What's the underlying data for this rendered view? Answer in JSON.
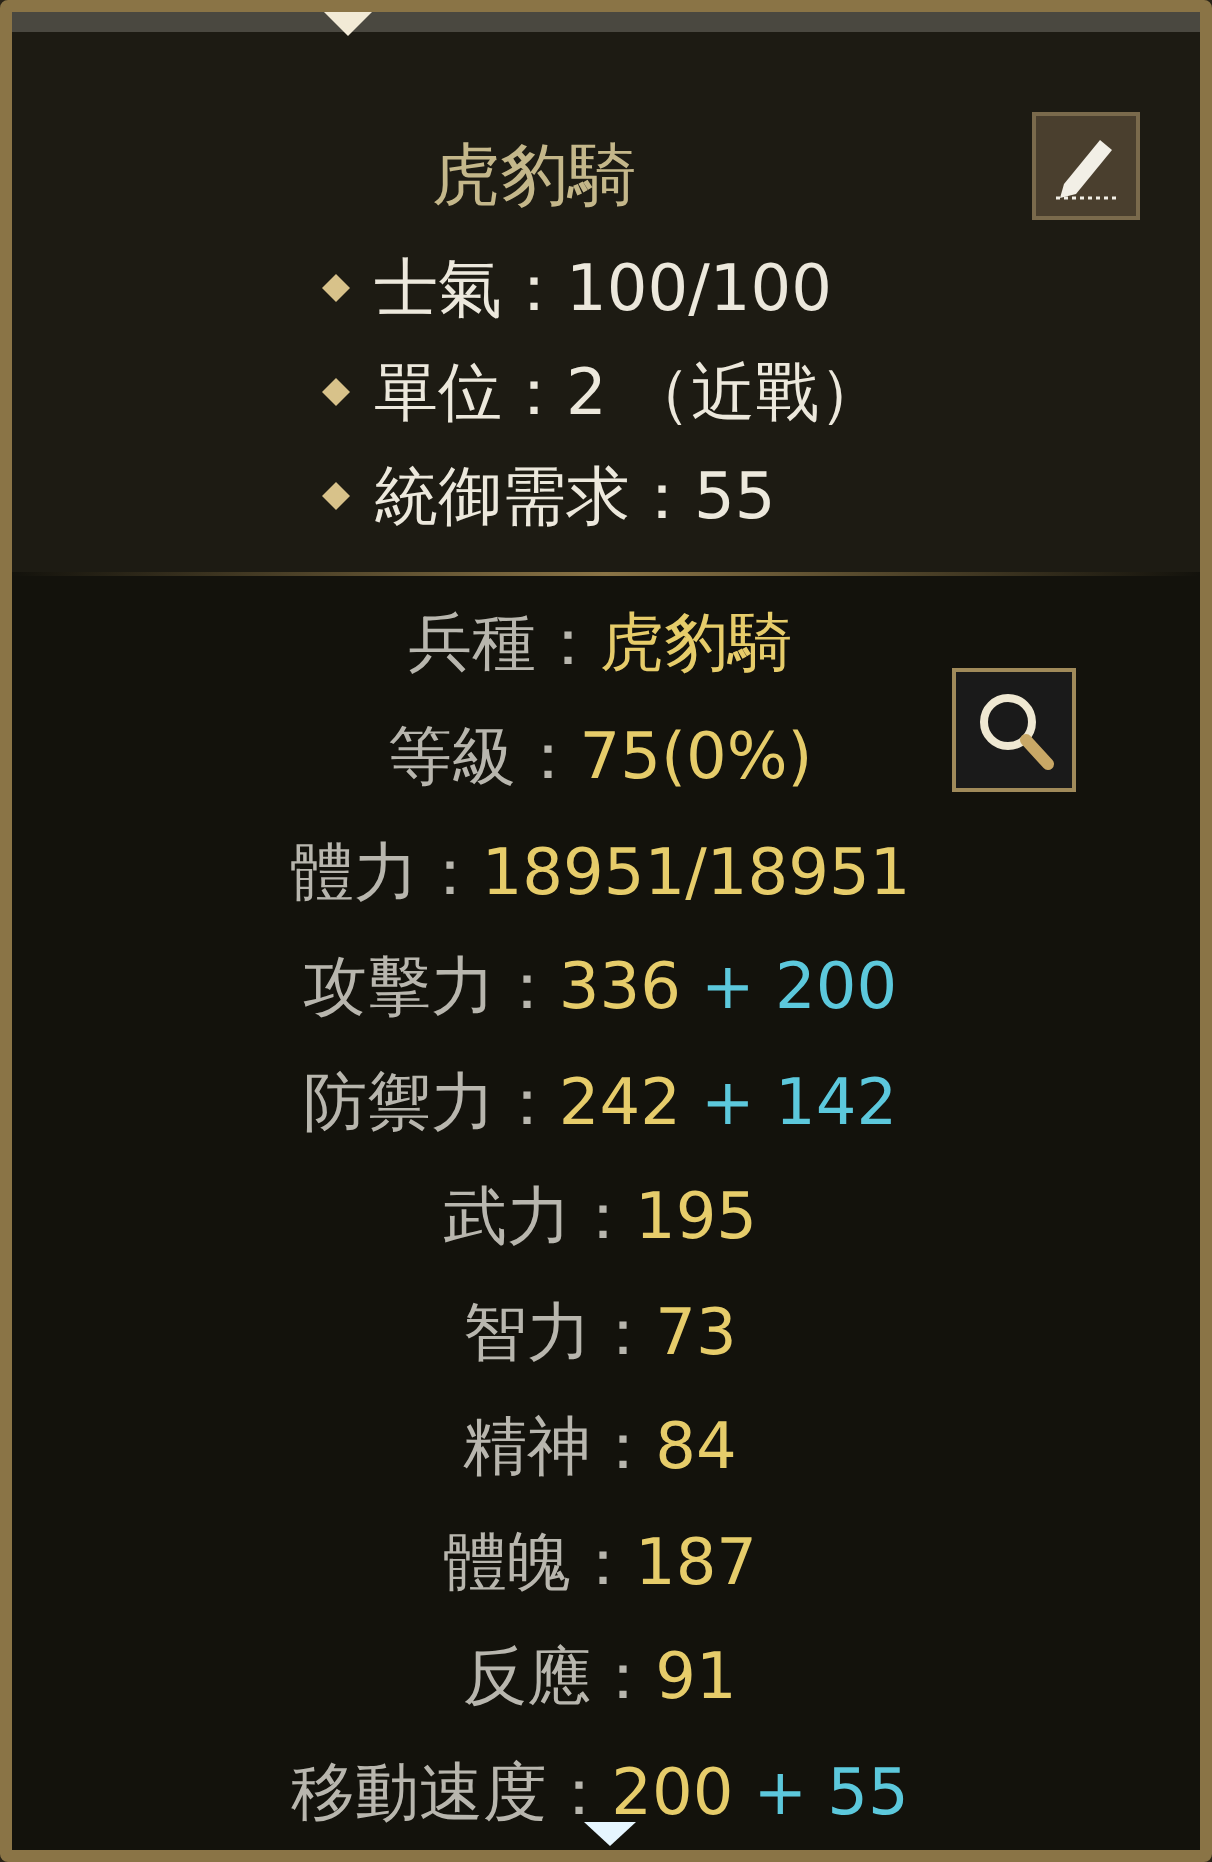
{
  "header": {
    "title": "虎豹騎",
    "details": [
      {
        "label": "士氣：",
        "value": "100/100"
      },
      {
        "label": "單位：",
        "value": "2 （近戰）"
      },
      {
        "label": "統御需求：",
        "value": "55"
      }
    ]
  },
  "stats": [
    {
      "label": "兵種：",
      "value": "虎豹騎"
    },
    {
      "label": "等級：",
      "value": "75(0%)"
    },
    {
      "label": "體力：",
      "value": "18951/18951"
    },
    {
      "label": "攻擊力：",
      "value": "336",
      "bonus": "+ 200"
    },
    {
      "label": "防禦力：",
      "value": "242",
      "bonus": "+ 142"
    },
    {
      "label": "武力：",
      "value": "195"
    },
    {
      "label": "智力：",
      "value": "73"
    },
    {
      "label": "精神：",
      "value": "84"
    },
    {
      "label": "體魄：",
      "value": "187"
    },
    {
      "label": "反應：",
      "value": "91"
    },
    {
      "label": "移動速度：",
      "value": "200",
      "bonus": "+ 55"
    }
  ]
}
